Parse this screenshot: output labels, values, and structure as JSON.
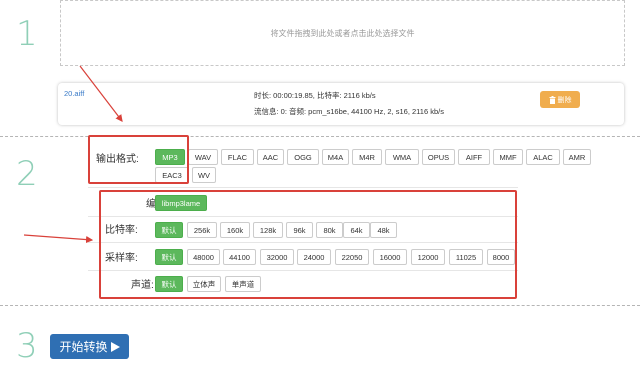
{
  "steps": {
    "one": "1",
    "two": "2",
    "three": "3"
  },
  "dropzone": {
    "text": "将文件拖拽到此处或者点击此处选择文件"
  },
  "file": {
    "name": "20.aiff",
    "duration_line": "时长: 00:00:19.85, 比特率: 2116 kb/s",
    "stream_line": "流信息: 0: 音频: pcm_s16be, 44100 Hz, 2, s16, 2116 kb/s",
    "delete_label": "删除",
    "delete_icon": "trash-icon"
  },
  "output_format": {
    "label": "输出格式:",
    "selected": "MP3",
    "options": [
      "MP3",
      "WAV",
      "FLAC",
      "AAC",
      "OGG",
      "M4A",
      "M4R",
      "WMA",
      "OPUS",
      "AIFF",
      "MMF",
      "ALAC",
      "AMR",
      "EAC3",
      "WV"
    ]
  },
  "encoder": {
    "label": "编码:",
    "options": [
      "libmp3lame"
    ],
    "selected": "libmp3lame"
  },
  "bitrate": {
    "label": "比特率:",
    "selected": "默认",
    "options": [
      "默认",
      "256k",
      "160k",
      "128k",
      "96k",
      "80k",
      "64k",
      "48k"
    ]
  },
  "samplerate": {
    "label": "采样率:",
    "selected": "默认",
    "options": [
      "默认",
      "48000",
      "44100",
      "32000",
      "24000",
      "22050",
      "16000",
      "12000",
      "11025",
      "8000"
    ]
  },
  "channels": {
    "label": "声道:",
    "selected": "默认",
    "options": [
      "默认",
      "立体声",
      "单声道"
    ]
  },
  "start_button": {
    "label": "开始转换",
    "icon": "play-triangle-icon"
  },
  "colors": {
    "accent_green": "#5cb85c",
    "warning_orange": "#f0ad4e",
    "primary_blue": "#2f6fb3",
    "highlight_red": "#d9413a",
    "step_number": "#8fcfb7"
  }
}
